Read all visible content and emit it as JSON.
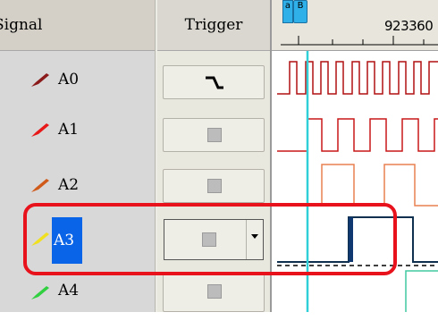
{
  "headers": {
    "signal": "Signal",
    "trigger": "Trigger",
    "time": "923360"
  },
  "markers": {
    "a": "a",
    "b": "B"
  },
  "signals": [
    {
      "label": "A0",
      "probe_color": "#8b1a1a",
      "trigger": "falling-edge"
    },
    {
      "label": "A1",
      "probe_color": "#e81818",
      "trigger": "dont-care"
    },
    {
      "label": "A2",
      "probe_color": "#d05a1a",
      "trigger": "dont-care"
    },
    {
      "label": "A3",
      "probe_color": "#f0e020",
      "trigger": "dont-care",
      "selected": true
    },
    {
      "label": "A4",
      "probe_color": "#30d040",
      "trigger": "dont-care"
    }
  ],
  "colors": {
    "highlight": "#e8121c",
    "cursor": "#30d0d8",
    "selection": "#0a64e8"
  }
}
